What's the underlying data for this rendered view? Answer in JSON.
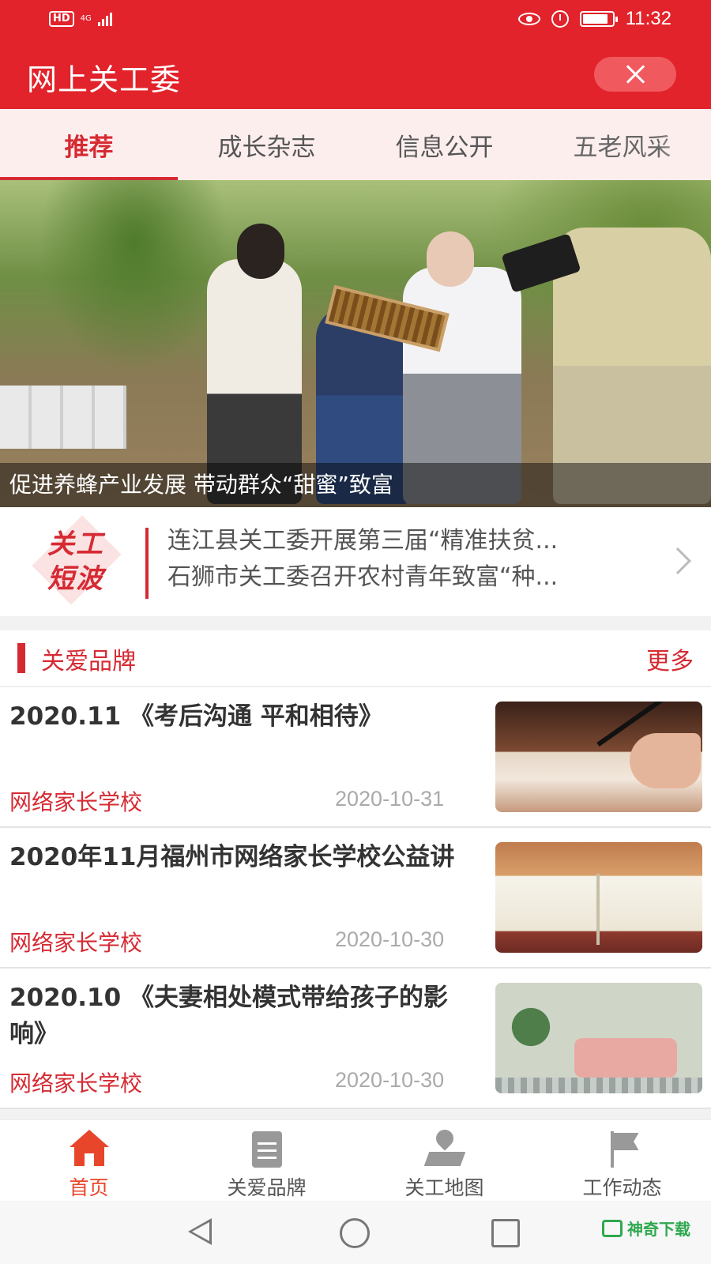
{
  "status_bar": {
    "hd": "HD",
    "network": "4G",
    "time": "11:32"
  },
  "header": {
    "title": "网上关工委"
  },
  "tabs": [
    {
      "label": "推荐",
      "active": true
    },
    {
      "label": "成长杂志",
      "active": false
    },
    {
      "label": "信息公开",
      "active": false
    },
    {
      "label": "五老风采",
      "active": false
    }
  ],
  "banner": {
    "caption": "促进养蜂产业发展 带动群众“甜蜜”致富"
  },
  "ticker": {
    "logo_line1": "关工",
    "logo_line2": "短波",
    "items": [
      "连江县关工委开展第三届“精准扶贫...",
      "石狮市关工委召开农村青年致富“种..."
    ]
  },
  "section": {
    "title": "关爱品牌",
    "more": "更多"
  },
  "articles": [
    {
      "title": "2020.11 《考后沟通 平和相待》",
      "source": "网络家长学校",
      "date": "2020-10-31"
    },
    {
      "title": "2020年11月福州市网络家长学校公益讲",
      "source": "网络家长学校",
      "date": "2020-10-30"
    },
    {
      "title": "2020.10 《夫妻相处模式带给孩子的影响》",
      "source": "网络家长学校",
      "date": "2020-10-30"
    }
  ],
  "bottom_nav": [
    {
      "label": "首页",
      "icon": "home-icon",
      "active": true
    },
    {
      "label": "关爱品牌",
      "icon": "document-icon",
      "active": false
    },
    {
      "label": "关工地图",
      "icon": "map-pin-icon",
      "active": false
    },
    {
      "label": "工作动态",
      "icon": "flag-icon",
      "active": false
    }
  ],
  "watermark": {
    "text": "神奇下载"
  },
  "colors": {
    "brand_red": "#e2232b",
    "accent_red": "#d62a33",
    "nav_active": "#e8462a"
  }
}
